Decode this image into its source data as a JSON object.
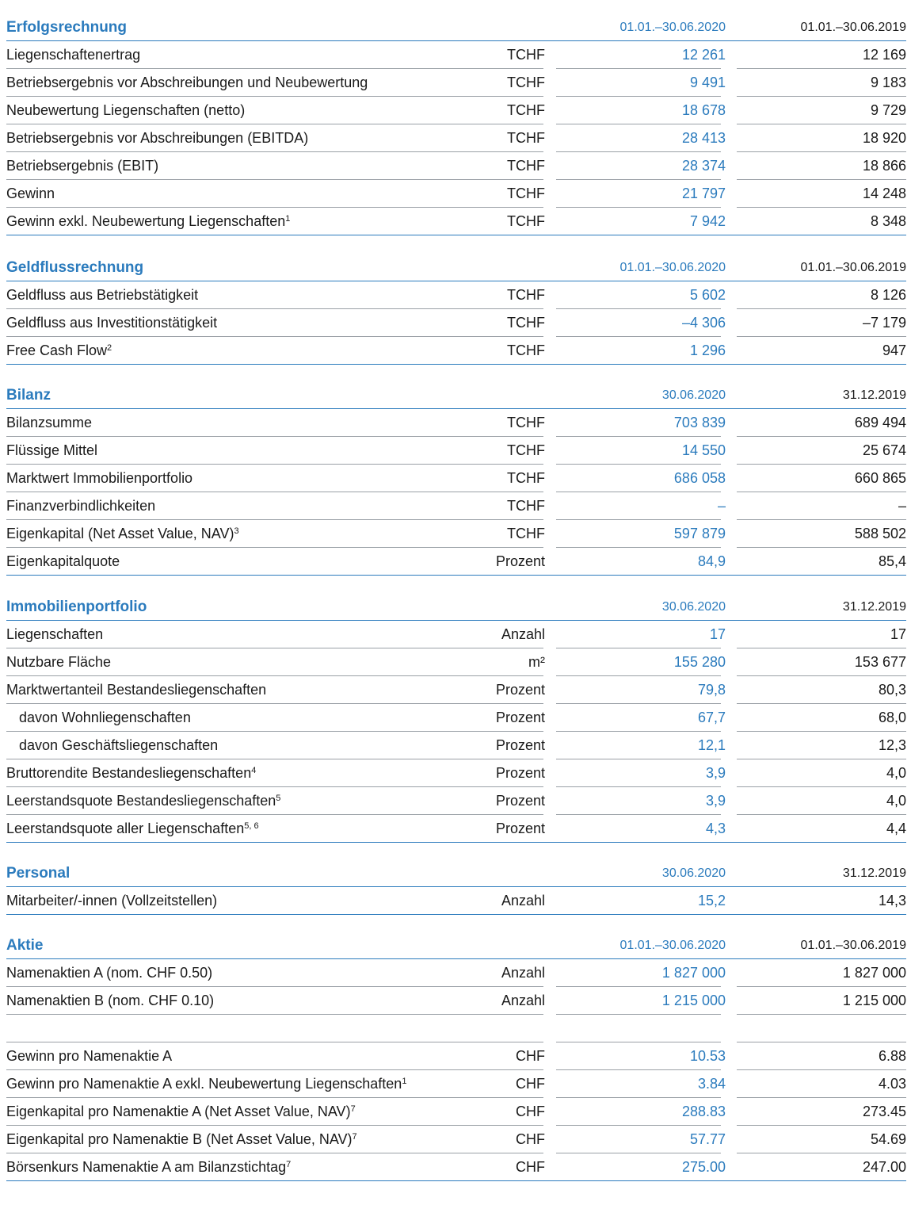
{
  "colors": {
    "accent": "#2b7bbd",
    "rule": "#9aa0a6",
    "text": "#1a1a1a"
  },
  "sections": [
    {
      "key": "erfolg",
      "title": "Erfolgsrechnung",
      "col1": "01.01.–30.06.2020",
      "col2": "01.01.–30.06.2019",
      "rows": [
        {
          "label": "Liegenschaftenertrag",
          "sup": "",
          "unit": "TCHF",
          "v1": "12 261",
          "v2": "12 169"
        },
        {
          "label": "Betriebsergebnis vor Abschreibungen und Neubewertung",
          "sup": "",
          "unit": "TCHF",
          "v1": "9 491",
          "v2": "9 183"
        },
        {
          "label": "Neubewertung Liegenschaften (netto)",
          "sup": "",
          "unit": "TCHF",
          "v1": "18 678",
          "v2": "9 729"
        },
        {
          "label": "Betriebsergebnis vor Abschreibungen (EBITDA)",
          "sup": "",
          "unit": "TCHF",
          "v1": "28 413",
          "v2": "18 920"
        },
        {
          "label": "Betriebsergebnis (EBIT)",
          "sup": "",
          "unit": "TCHF",
          "v1": "28 374",
          "v2": "18 866"
        },
        {
          "label": "Gewinn",
          "sup": "",
          "unit": "TCHF",
          "v1": "21 797",
          "v2": "14 248"
        },
        {
          "label": "Gewinn exkl. Neubewertung Liegenschaften",
          "sup": "1",
          "unit": "TCHF",
          "v1": "7 942",
          "v2": "8 348"
        }
      ]
    },
    {
      "key": "geldfluss",
      "title": "Geldflussrechnung",
      "col1": "01.01.–30.06.2020",
      "col2": "01.01.–30.06.2019",
      "rows": [
        {
          "label": "Geldfluss aus Betriebstätigkeit",
          "sup": "",
          "unit": "TCHF",
          "v1": "5 602",
          "v2": "8 126"
        },
        {
          "label": "Geldfluss aus Investitionstätigkeit",
          "sup": "",
          "unit": "TCHF",
          "v1": "–4 306",
          "v2": "–7 179"
        },
        {
          "label": "Free Cash Flow",
          "sup": "2",
          "unit": "TCHF",
          "v1": "1 296",
          "v2": "947"
        }
      ]
    },
    {
      "key": "bilanz",
      "title": "Bilanz",
      "col1": "30.06.2020",
      "col2": "31.12.2019",
      "rows": [
        {
          "label": "Bilanzsumme",
          "sup": "",
          "unit": "TCHF",
          "v1": "703 839",
          "v2": "689 494"
        },
        {
          "label": "Flüssige Mittel",
          "sup": "",
          "unit": "TCHF",
          "v1": "14 550",
          "v2": "25 674"
        },
        {
          "label": "Marktwert Immobilienportfolio",
          "sup": "",
          "unit": "TCHF",
          "v1": "686 058",
          "v2": "660 865"
        },
        {
          "label": "Finanzverbindlichkeiten",
          "sup": "",
          "unit": "TCHF",
          "v1": "–",
          "v2": "–"
        },
        {
          "label": "Eigenkapital (Net Asset Value, NAV)",
          "sup": "3",
          "unit": "TCHF",
          "v1": "597 879",
          "v2": "588 502"
        },
        {
          "label": "Eigenkapitalquote",
          "sup": "",
          "unit": "Prozent",
          "v1": "84,9",
          "v2": "85,4"
        }
      ]
    },
    {
      "key": "portfolio",
      "title": "Immobilienportfolio",
      "col1": "30.06.2020",
      "col2": "31.12.2019",
      "rows": [
        {
          "label": "Liegenschaften",
          "sup": "",
          "unit": "Anzahl",
          "v1": "17",
          "v2": "17"
        },
        {
          "label": "Nutzbare Fläche",
          "sup": "",
          "unit": "m²",
          "v1": "155 280",
          "v2": "153 677"
        },
        {
          "label": "Marktwertanteil Bestandesliegenschaften",
          "sup": "",
          "unit": "Prozent",
          "v1": "79,8",
          "v2": "80,3"
        },
        {
          "label": "davon Wohnliegenschaften",
          "sup": "",
          "unit": "Prozent",
          "v1": "67,7",
          "v2": "68,0",
          "indent": true
        },
        {
          "label": "davon Geschäftsliegenschaften",
          "sup": "",
          "unit": "Prozent",
          "v1": "12,1",
          "v2": "12,3",
          "indent": true
        },
        {
          "label": "Bruttorendite Bestandesliegenschaften",
          "sup": "4",
          "unit": "Prozent",
          "v1": "3,9",
          "v2": "4,0"
        },
        {
          "label": "Leerstandsquote Bestandesliegenschaften",
          "sup": "5",
          "unit": "Prozent",
          "v1": "3,9",
          "v2": "4,0"
        },
        {
          "label": "Leerstandsquote aller Liegenschaften",
          "sup": "5, 6",
          "unit": "Prozent",
          "v1": "4,3",
          "v2": "4,4"
        }
      ]
    },
    {
      "key": "personal",
      "title": "Personal",
      "col1": "30.06.2020",
      "col2": "31.12.2019",
      "rows": [
        {
          "label": "Mitarbeiter/-innen (Vollzeitstellen)",
          "sup": "",
          "unit": "Anzahl",
          "v1": "15,2",
          "v2": "14,3"
        }
      ]
    },
    {
      "key": "aktie",
      "title": "Aktie",
      "col1": "01.01.–30.06.2020",
      "col2": "01.01.–30.06.2019",
      "rows": [
        {
          "label": "Namenaktien A (nom. CHF 0.50)",
          "sup": "",
          "unit": "Anzahl",
          "v1": "1 827 000",
          "v2": "1 827 000"
        },
        {
          "label": "Namenaktien B (nom. CHF 0.10)",
          "sup": "",
          "unit": "Anzahl",
          "v1": "1 215 000",
          "v2": "1 215 000"
        }
      ],
      "rows2": [
        {
          "label": "Gewinn pro Namenaktie A",
          "sup": "",
          "unit": "CHF",
          "v1": "10.53",
          "v2": "6.88"
        },
        {
          "label": "Gewinn pro Namenaktie A exkl. Neubewertung Liegenschaften",
          "sup": "1",
          "unit": "CHF",
          "v1": "3.84",
          "v2": "4.03"
        },
        {
          "label": "Eigenkapital pro Namenaktie A (Net Asset Value, NAV)",
          "sup": "7",
          "unit": "CHF",
          "v1": "288.83",
          "v2": "273.45"
        },
        {
          "label": "Eigenkapital pro Namenaktie B (Net Asset Value, NAV)",
          "sup": "7",
          "unit": "CHF",
          "v1": "57.77",
          "v2": "54.69"
        },
        {
          "label": "Börsenkurs Namenaktie A am Bilanzstichtag",
          "sup": "7",
          "unit": "CHF",
          "v1": "275.00",
          "v2": "247.00"
        }
      ]
    }
  ]
}
